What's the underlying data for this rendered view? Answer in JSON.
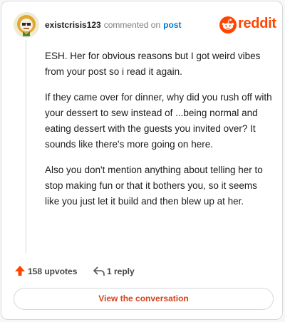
{
  "comment": {
    "username": "existcrisis123",
    "action_text": "commented on",
    "post_link_text": "post",
    "paragraphs": [
      "ESH. Her for obvious reasons but I got weird vibes from your post so i read it again.",
      "If they came over for dinner, why did you rush off with your dessert to sew instead of ...being normal and eating dessert with the guests you invited over? It sounds like there's more going on here.",
      "Also you don't mention anything about telling her to stop making fun or that it bothers you, so it seems like you just let it build and then blew up at her."
    ]
  },
  "brand": {
    "name": "reddit",
    "icon": "reddit-snoo-icon",
    "color": "#ff4500"
  },
  "actions": {
    "upvotes_label": "158 upvotes",
    "replies_label": "1 reply",
    "upvote_icon": "upvote-arrow-icon",
    "reply_icon": "reply-arrow-icon"
  },
  "footer": {
    "view_button_label": "View the conversation"
  },
  "colors": {
    "accent": "#ff4500",
    "link": "#0079d3",
    "button_text": "#d4431d"
  }
}
